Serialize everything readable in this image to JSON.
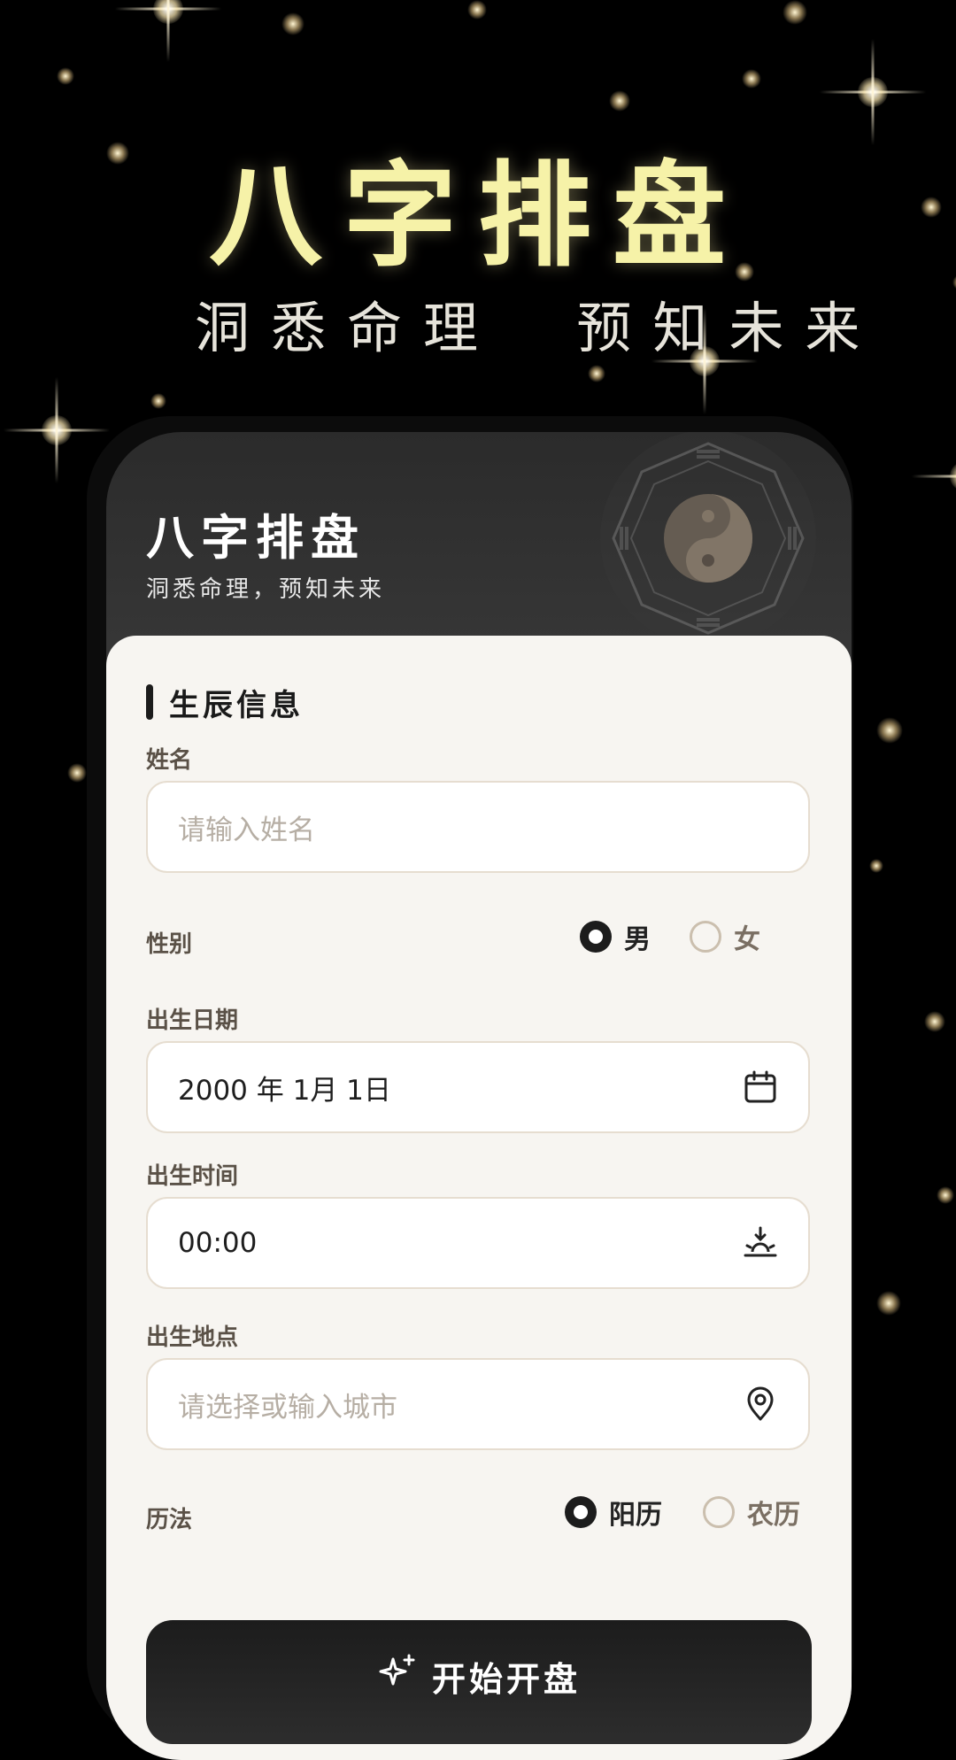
{
  "hero": {
    "title": "八字排盘",
    "subtitle": "洞悉命理  预知未来"
  },
  "card": {
    "title": "八字排盘",
    "subtitle": "洞悉命理，预知未来"
  },
  "form": {
    "section_title": "生辰信息",
    "name": {
      "label": "姓名",
      "value": "",
      "placeholder": "请输入姓名"
    },
    "gender": {
      "label": "性别",
      "options": [
        "男",
        "女"
      ],
      "selected": "男"
    },
    "birth_date": {
      "label": "出生日期",
      "value": "2000 年 1月 1日",
      "icon": "calendar-icon"
    },
    "birth_time": {
      "label": "出生时间",
      "value": "00:00",
      "icon": "sunrise-icon"
    },
    "birth_place": {
      "label": "出生地点",
      "value": "",
      "placeholder": "请选择或输入城市",
      "icon": "location-pin-icon"
    },
    "calendar": {
      "label": "历法",
      "options": [
        "阳历",
        "农历"
      ],
      "selected": "阳历"
    },
    "submit_label": "开始开盘"
  },
  "colors": {
    "hero_title": "#f6f2a8",
    "panel_bg": "#f7f5f1",
    "button_bg": "#1c1c1c",
    "input_border": "#e6ddd0"
  }
}
